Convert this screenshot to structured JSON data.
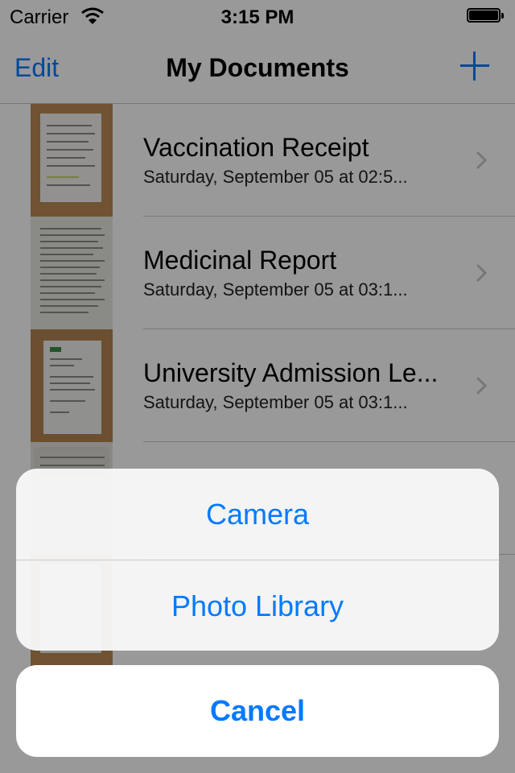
{
  "status_bar": {
    "carrier": "Carrier",
    "time": "3:15 PM",
    "wifi_icon": "wifi-icon",
    "battery_icon": "battery-icon"
  },
  "nav_bar": {
    "edit_label": "Edit",
    "title": "My Documents",
    "add_icon": "plus-icon",
    "accent_color": "#007aff"
  },
  "documents": [
    {
      "title": "Vaccination Receipt",
      "date": "Saturday, September 05 at 02:5..."
    },
    {
      "title": "Medicinal Report",
      "date": "Saturday, September 05 at 03:1..."
    },
    {
      "title": "University Admission Le...",
      "date": "Saturday, September 05 at 03:1..."
    },
    {
      "title": "",
      "date": ""
    },
    {
      "title": "",
      "date": ""
    }
  ],
  "action_sheet": {
    "options": [
      {
        "label": "Camera"
      },
      {
        "label": "Photo Library"
      }
    ],
    "cancel_label": "Cancel"
  }
}
